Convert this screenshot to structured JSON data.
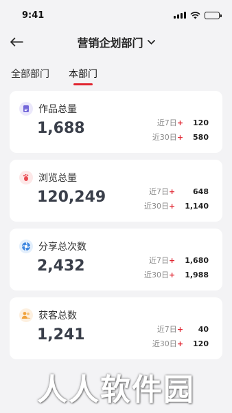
{
  "status_bar": {
    "time": "9:41"
  },
  "header": {
    "title": "营销企划部门"
  },
  "tabs": [
    {
      "label": "全部部门",
      "active": false
    },
    {
      "label": "本部门",
      "active": true
    }
  ],
  "accent_color": "#e0242f",
  "cards": [
    {
      "icon": "works-icon",
      "label": "作品总量",
      "total": "1,688",
      "stat7_label": "近7日",
      "stat7_value": "120",
      "stat30_label": "近30日",
      "stat30_value": "580"
    },
    {
      "icon": "footprint-icon",
      "label": "浏览总量",
      "total": "120,249",
      "stat7_label": "近7日",
      "stat7_value": "648",
      "stat30_label": "近30日",
      "stat30_value": "1,140"
    },
    {
      "icon": "share-icon",
      "label": "分享总次数",
      "total": "2,432",
      "stat7_label": "近7日",
      "stat7_value": "1,680",
      "stat30_label": "近30日",
      "stat30_value": "1,988"
    },
    {
      "icon": "customers-icon",
      "label": "获客总数",
      "total": "1,241",
      "stat7_label": "近7日",
      "stat7_value": "40",
      "stat30_label": "近30日",
      "stat30_value": "120"
    }
  ],
  "watermark": "人人软件园"
}
